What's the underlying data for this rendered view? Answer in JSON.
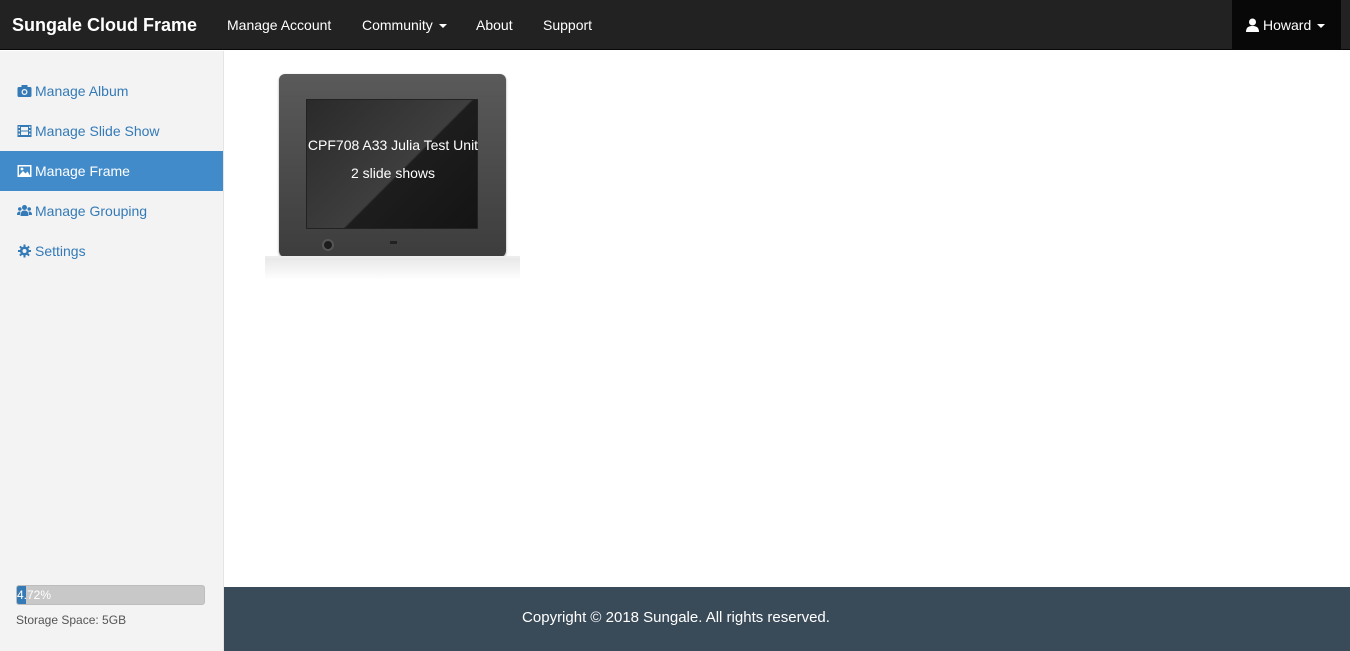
{
  "navbar": {
    "brand": "Sungale Cloud Frame",
    "links": [
      "Manage Account",
      "Community",
      "About",
      "Support"
    ],
    "user": "Howard"
  },
  "sidebar": {
    "items": [
      {
        "label": "Manage Album",
        "icon": "camera-icon"
      },
      {
        "label": "Manage Slide Show",
        "icon": "film-icon"
      },
      {
        "label": "Manage Frame",
        "icon": "picture-icon"
      },
      {
        "label": "Manage Grouping",
        "icon": "users-icon"
      },
      {
        "label": "Settings",
        "icon": "gear-icon"
      }
    ],
    "active": "Manage Frame",
    "storage": {
      "percent": 4.72,
      "percent_label": "4.72%",
      "label": "Storage Space: 5GB"
    }
  },
  "main": {
    "frames": [
      {
        "name": "CPF708 A33 Julia Test Unit",
        "slide_shows": "2 slide shows"
      }
    ]
  },
  "footer": {
    "copyright": "Copyright © 2018 Sungale. All rights reserved."
  },
  "colors": {
    "navbar": "#222222",
    "accent": "#428bca",
    "link": "#337ab7",
    "footer": "#394a59"
  }
}
